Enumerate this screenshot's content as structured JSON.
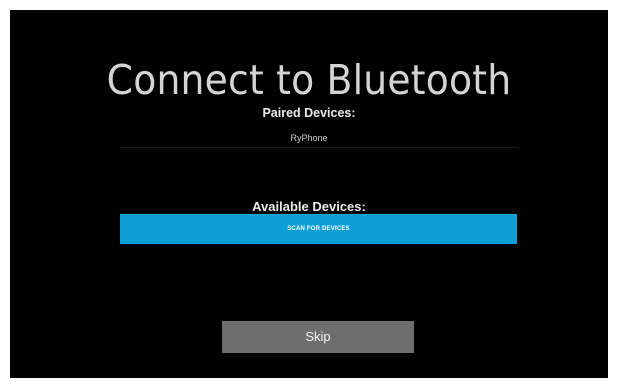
{
  "screen": {
    "title": "Connect to Bluetooth"
  },
  "paired": {
    "label": "Paired Devices:",
    "devices": [
      {
        "name": "RyPhone"
      }
    ]
  },
  "available": {
    "label": "Available Devices:",
    "scan_label": "SCAN FOR DEVICES"
  },
  "actions": {
    "skip_label": "Skip"
  },
  "colors": {
    "background": "#000000",
    "accent": "#0e9fd7",
    "skip_button": "#6e6e6e"
  }
}
